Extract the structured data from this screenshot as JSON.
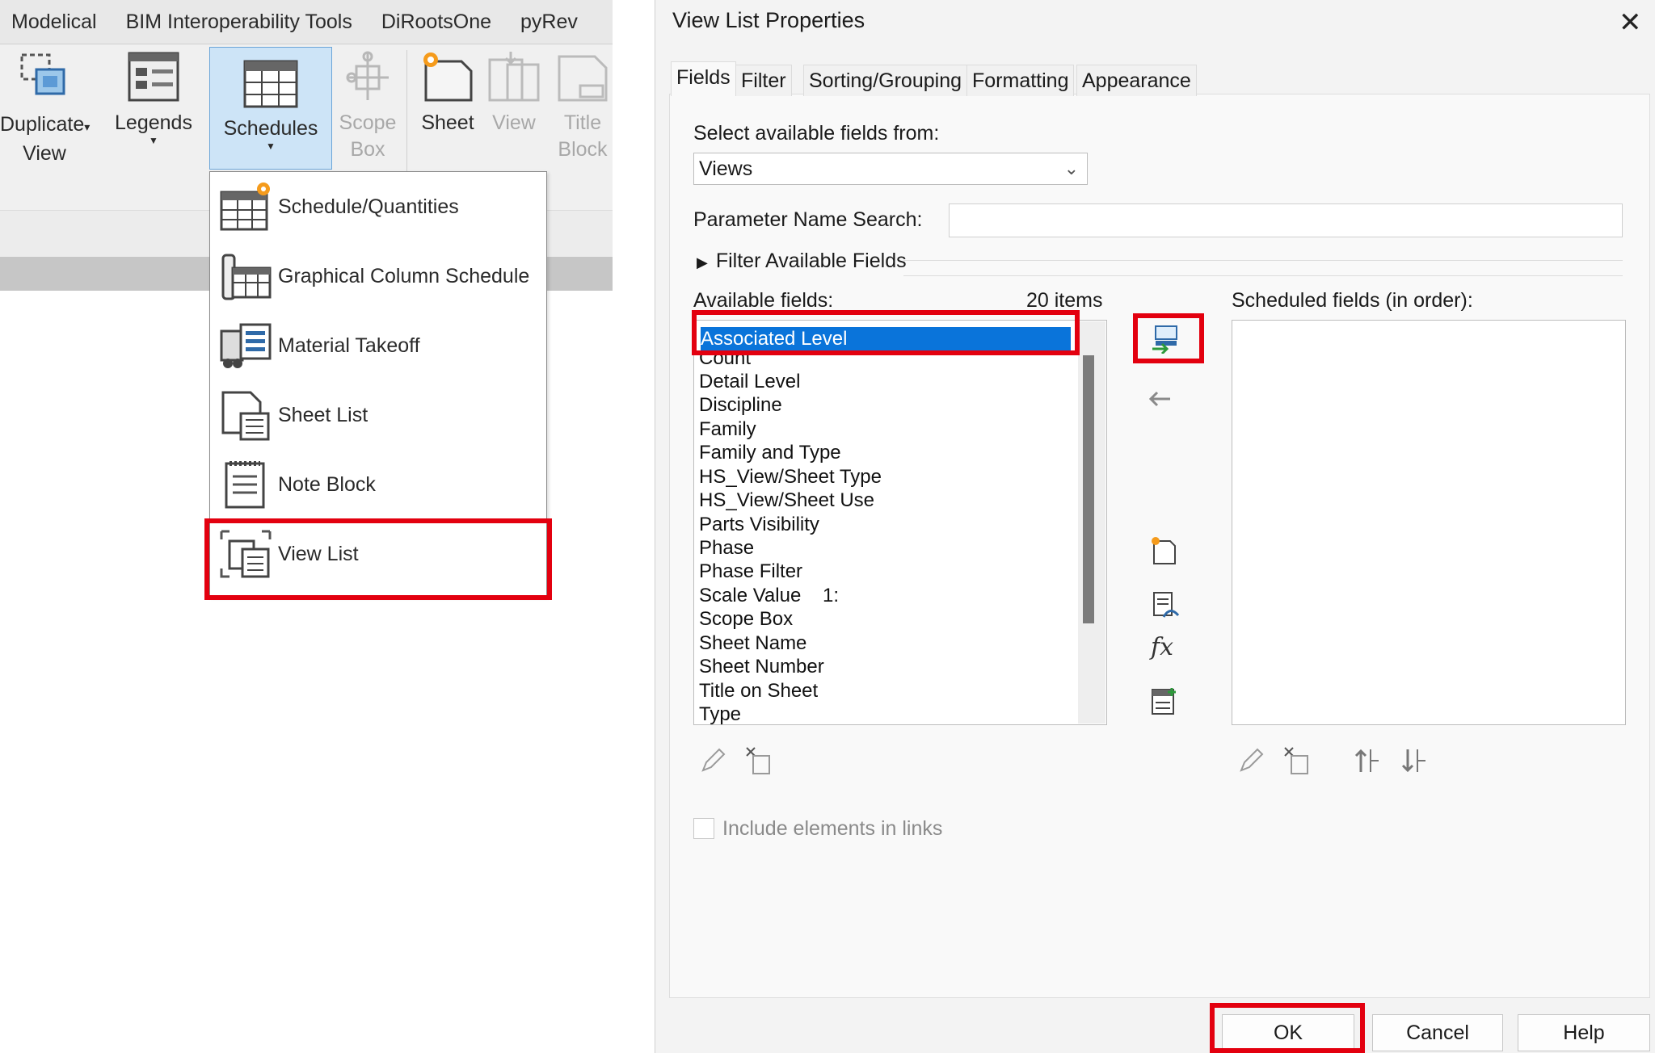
{
  "ribbon": {
    "tabs": [
      "Modelical",
      "BIM Interoperability Tools",
      "DiRootsOne",
      "pyRev"
    ],
    "buttons": {
      "duplicate_view": [
        "Duplicate",
        "View"
      ],
      "legends": "Legends",
      "schedules": "Schedules",
      "scope_box": [
        "Scope",
        "Box"
      ],
      "sheet": "Sheet",
      "view": "View",
      "title_block": [
        "Title",
        "Block"
      ]
    },
    "schedules_menu": [
      "Schedule/Quantities",
      "Graphical Column Schedule",
      "Material Takeoff",
      "Sheet List",
      "Note Block",
      "View List"
    ]
  },
  "dialog": {
    "title": "View List Properties",
    "close_glyph": "✕",
    "tabs": [
      "Fields",
      "Filter",
      "Sorting/Grouping",
      "Formatting",
      "Appearance"
    ],
    "select_from_label": "Select available fields from:",
    "select_from_value": "Views",
    "param_search_label": "Parameter Name Search:",
    "param_search_value": "",
    "filter_available_label": "Filter Available Fields",
    "available_label": "Available fields:",
    "available_count": "20 items",
    "scheduled_label": "Scheduled fields (in order):",
    "available_fields": [
      "Associated Level",
      "Count",
      "Detail Level",
      "Discipline",
      "Family",
      "Family and Type",
      "HS_View/Sheet Type",
      "HS_View/Sheet Use",
      "Parts Visibility",
      "Phase",
      "Phase Filter",
      "Scale Value    1:",
      "Scope Box",
      "Sheet Name",
      "Sheet Number",
      "Title on Sheet",
      "Type"
    ],
    "include_links_label": "Include elements in links",
    "buttons": {
      "ok": "OK",
      "cancel": "Cancel",
      "help": "Help"
    }
  },
  "colors": {
    "highlight_red": "#e3000f",
    "selection_blue": "#0a74da",
    "ribbon_active": "#cde4f7"
  }
}
